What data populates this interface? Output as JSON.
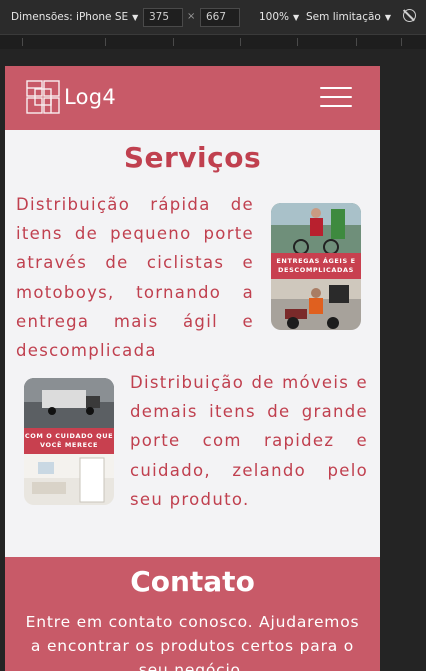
{
  "devtools": {
    "device_label": "Dimensões: iPhone SE",
    "width_value": "375",
    "times_symbol": "×",
    "height_value": "667",
    "zoom_label": "100%",
    "throttle_label": "Sem limitação",
    "caret": "▼"
  },
  "navbar": {
    "brand": "Log4",
    "menu_icon": "hamburger-icon"
  },
  "services": {
    "title": "Serviços",
    "item1_text": "Distribuição rápida de itens de pequeno porte através de ciclistas e motoboys, tornando a entrega mais ágil e descomplicada",
    "item1_badge": "ENTREGAS ÁGEIS E DESCOMPLICADAS",
    "item2_text": "Distribuição de móveis e demais itens de grande porte com rapidez e cuidado, zelando pelo seu produto.",
    "item2_badge": "COM O CUIDADO QUE VOCÊ MERECE"
  },
  "contact": {
    "title": "Contato",
    "text": "Entre em contato conosco. Ajudaremos a encontrar os produtos certos para o seu negócio."
  },
  "colors": {
    "brand": "#c85a68",
    "text_accent": "#c0404f",
    "background": "#f3f3f5"
  }
}
